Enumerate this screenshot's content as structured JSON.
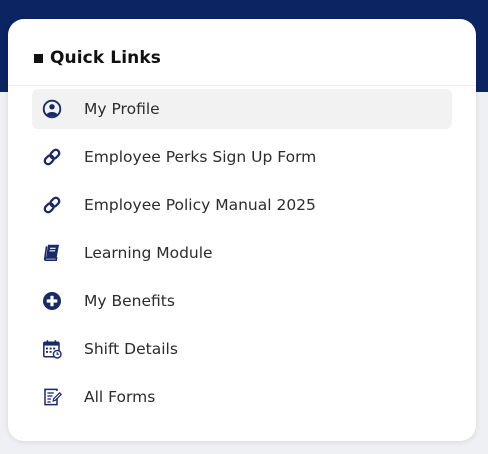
{
  "card": {
    "title": "Quick Links"
  },
  "links": [
    {
      "label": "My Profile",
      "icon": "user-circle-icon"
    },
    {
      "label": "Employee Perks Sign Up Form",
      "icon": "link-icon"
    },
    {
      "label": "Employee Policy Manual 2025",
      "icon": "link-icon"
    },
    {
      "label": "Learning Module",
      "icon": "book-icon"
    },
    {
      "label": "My Benefits",
      "icon": "plus-circle-icon"
    },
    {
      "label": "Shift Details",
      "icon": "calendar-clock-icon"
    },
    {
      "label": "All Forms",
      "icon": "form-edit-icon"
    }
  ],
  "colors": {
    "header_bg": "#0d2463",
    "icon": "#1a2a66",
    "active_row": "#f2f2f2"
  }
}
